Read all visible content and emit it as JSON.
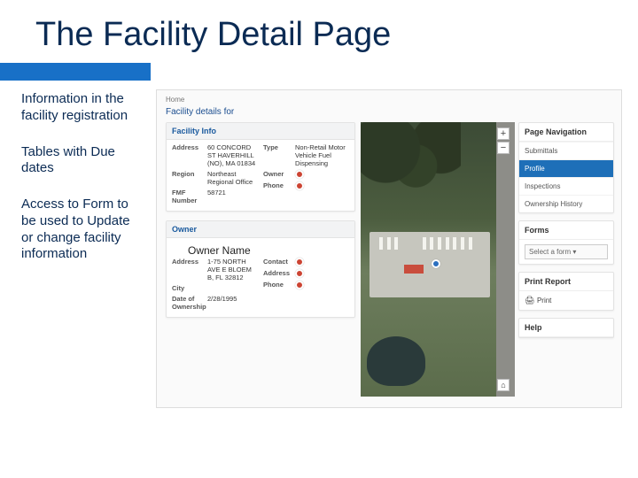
{
  "slide": {
    "title": "The Facility Detail Page"
  },
  "left": {
    "b1": "Information in the facility registration",
    "b2": "Tables with Due dates",
    "b3": "Access to Form to be used to Update or change facility information"
  },
  "browser": {
    "breadcrumb": "Home",
    "facDetailsFor": "Facility details for",
    "facilityInfo": {
      "header": "Facility Info",
      "address_k": "Address",
      "address_v": "60 CONCORD ST HAVERHILL (NO), MA 01834",
      "type_k": "Type",
      "type_v": "Non-Retail Motor Vehicle Fuel Dispensing",
      "region_k": "Region",
      "region_v": "Northeast Regional Office",
      "owner_k": "Owner",
      "owner_marker": "●",
      "fmf_k": "FMF Number",
      "fmf_v": "58721",
      "phone_k": "Phone",
      "phone_marker": "●"
    },
    "owner": {
      "header": "Owner",
      "overlay": "Owner Name",
      "address_k": "Address",
      "address_v": "1-75 NORTH AVE E BLOEM B, FL 32812",
      "contact_k": "Contact",
      "address2_k": "Address",
      "city_k": "City",
      "date_k": "Date of Ownership",
      "date_v": "2/28/1995",
      "phone_k": "Phone"
    },
    "nav": {
      "header": "Page Navigation",
      "items": [
        "Submittals",
        "Profile",
        "Inspections",
        "Ownership History"
      ]
    },
    "forms": {
      "header": "Forms",
      "select_placeholder": "Select a form ▾"
    },
    "print": {
      "header": "Print Report",
      "label": "Print"
    },
    "help": {
      "header": "Help"
    },
    "map": {
      "zoom_in": "+",
      "zoom_out": "−",
      "home": "⌂"
    }
  }
}
